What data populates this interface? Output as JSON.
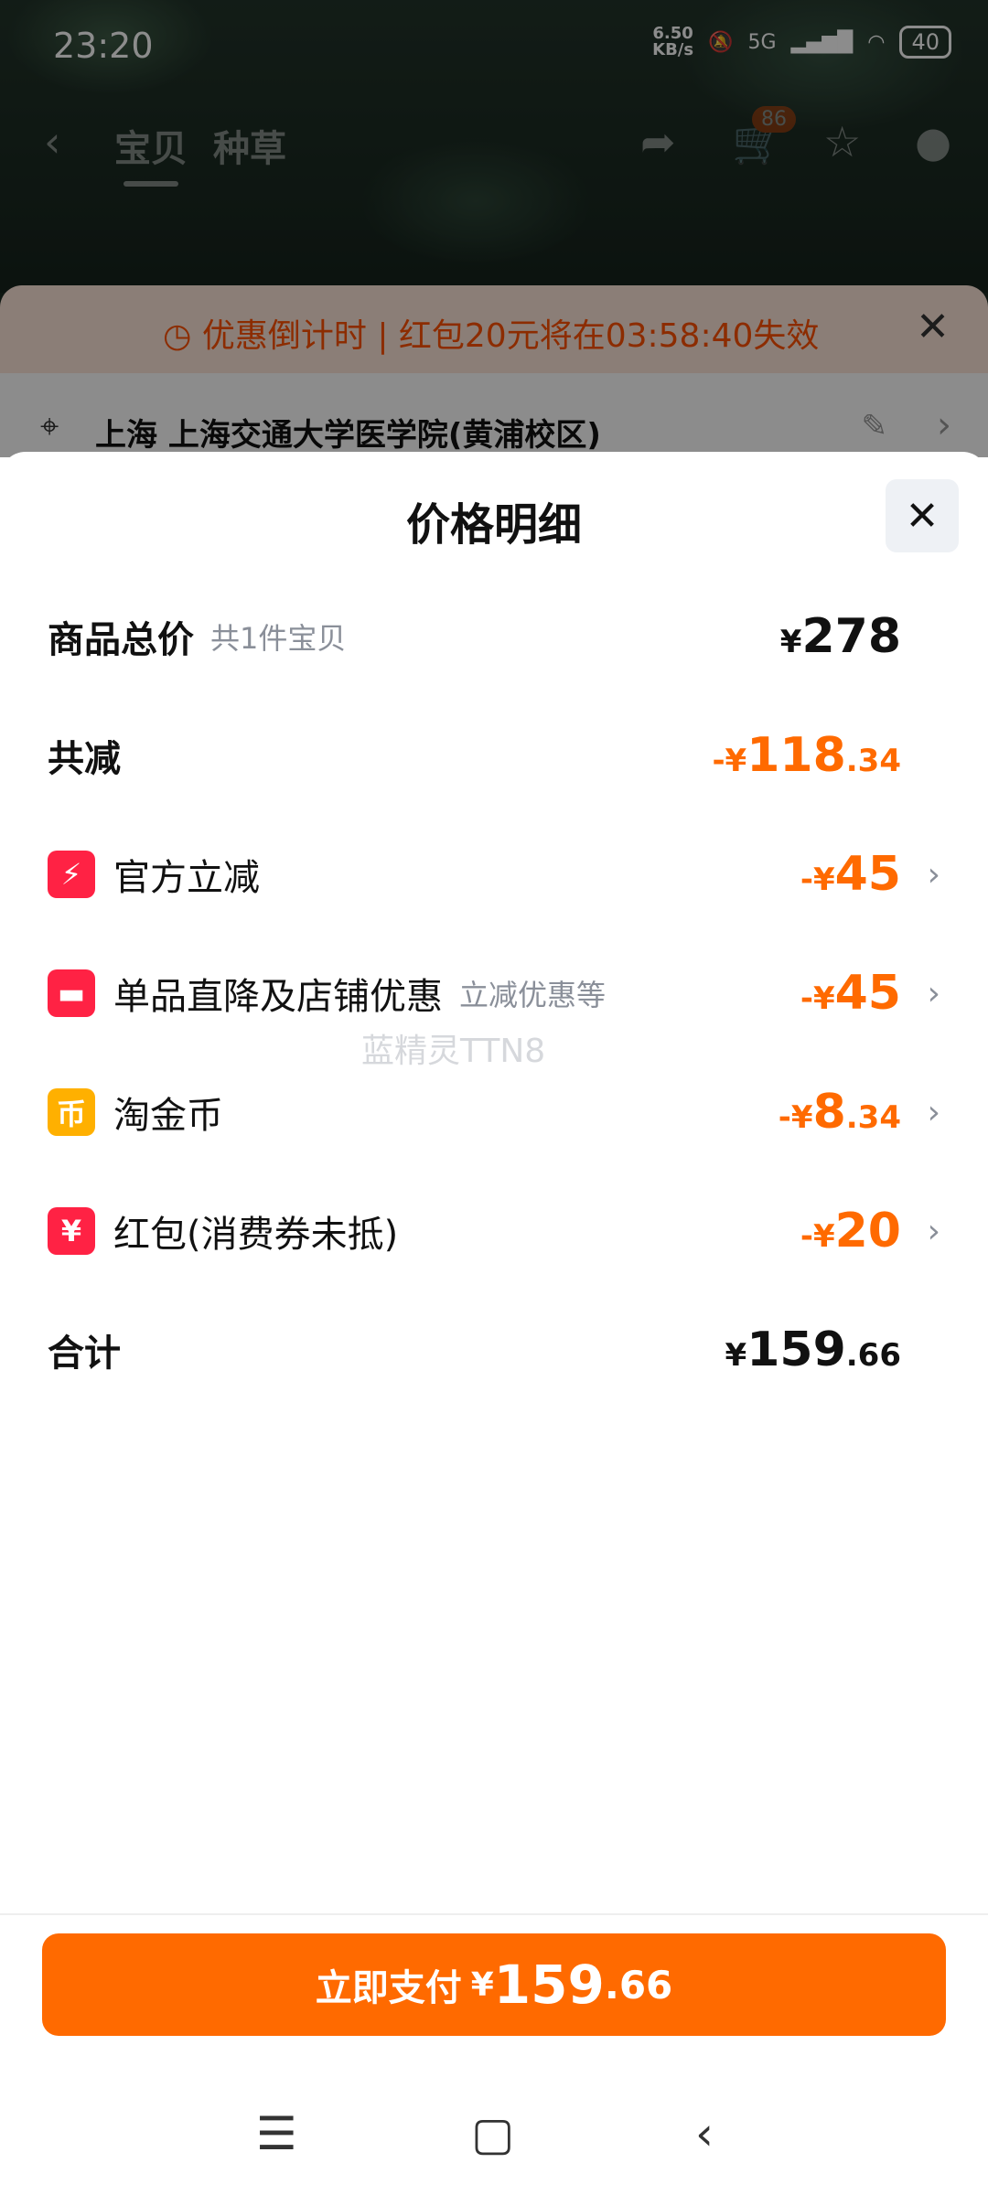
{
  "status_bar": {
    "time": "23:20",
    "net_speed_value": "6.50",
    "net_speed_unit": "KB/s",
    "network": "5G",
    "battery": "40"
  },
  "top_nav": {
    "tabs": [
      "宝贝",
      "种草"
    ],
    "cart_badge": "86",
    "icons": [
      "back-icon",
      "share-icon",
      "cart-icon",
      "star-icon",
      "message-icon"
    ]
  },
  "countdown_banner": {
    "text": "优惠倒计时 | 红包20元将在03:58:40失效"
  },
  "address": {
    "text": "上海 上海交通大学医学院(黄浦校区)"
  },
  "sheet": {
    "title": "价格明细",
    "rows": [
      {
        "label": "商品总价",
        "sub": "共1件宝贝",
        "yen": "¥",
        "int": "278",
        "dec": ""
      },
      {
        "label": "共减",
        "sub": "",
        "yen": "-¥",
        "int": "118",
        "dec": ".34"
      },
      {
        "label": "官方立减",
        "sub": "",
        "yen": "-¥",
        "int": "45",
        "dec": ""
      },
      {
        "label": "单品直降及店铺优惠",
        "sub": "立减优惠等",
        "yen": "-¥",
        "int": "45",
        "dec": ""
      },
      {
        "label": "淘金币",
        "sub": "",
        "yen": "-¥",
        "int": "8",
        "dec": ".34"
      },
      {
        "label": "红包(消费券未抵)",
        "sub": "",
        "yen": "-¥",
        "int": "20",
        "dec": ""
      },
      {
        "label": "合计",
        "sub": "",
        "yen": "¥",
        "int": "159",
        "dec": ".66"
      }
    ],
    "watermark": "蓝精灵TTN8"
  },
  "pay_button": {
    "label": "立即支付",
    "yen": "¥",
    "int": "159",
    "dec": ".66"
  },
  "colors": {
    "accent": "#ff6a00",
    "badge_red": "#ff2244",
    "coin_yellow": "#ffb000"
  }
}
